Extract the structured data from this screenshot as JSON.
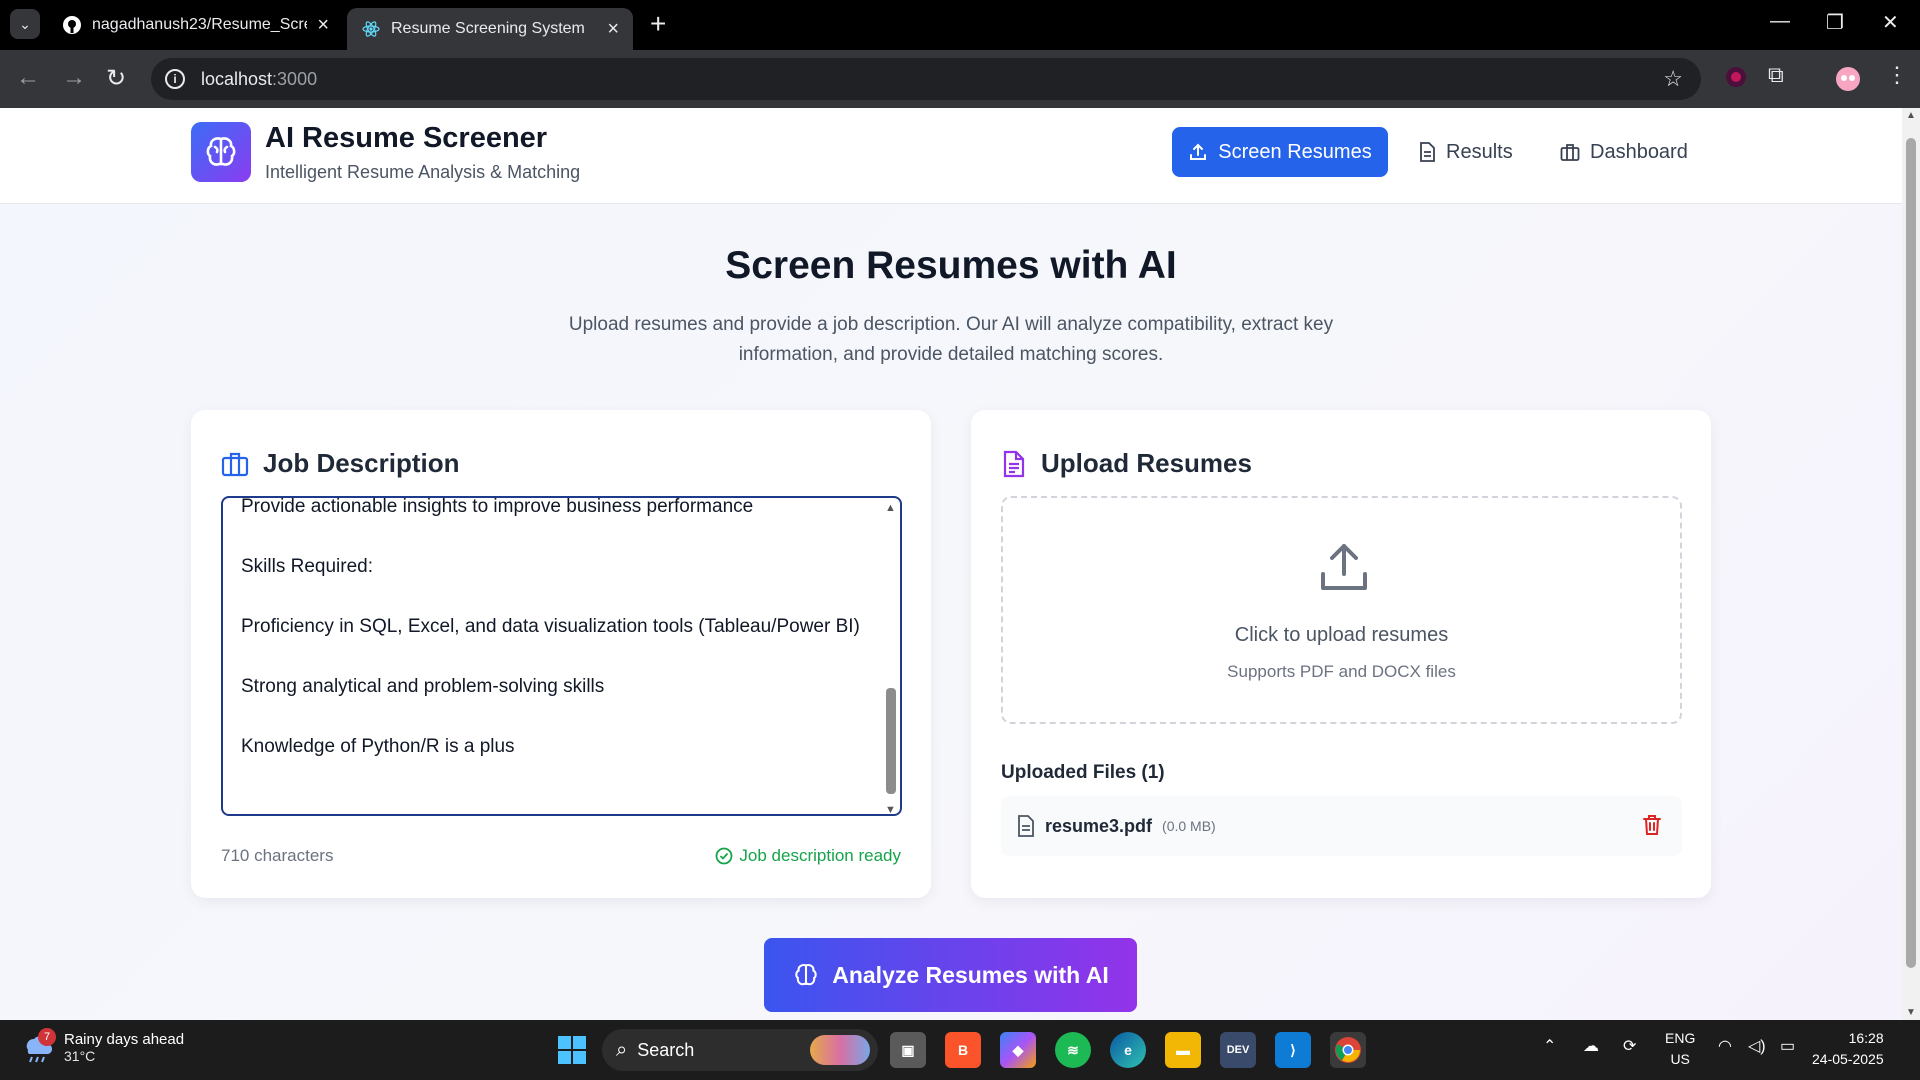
{
  "browser": {
    "tabs": [
      {
        "title": "nagadhanush23/Resume_Scree"
      },
      {
        "title": "Resume Screening System"
      }
    ],
    "url_host": "localhost",
    "url_port": ":3000"
  },
  "header": {
    "title": "AI Resume Screener",
    "subtitle": "Intelligent Resume Analysis & Matching",
    "nav": {
      "screen": "Screen Resumes",
      "results": "Results",
      "dashboard": "Dashboard"
    }
  },
  "hero": {
    "title": "Screen Resumes with AI",
    "subtitle": "Upload resumes and provide a job description. Our AI will analyze compatibility, extract key information, and provide detailed matching scores."
  },
  "job_description": {
    "heading": "Job Description",
    "text": "Provide actionable insights to improve business performance\n\nSkills Required:\n\nProficiency in SQL, Excel, and data visualization tools (Tableau/Power BI)\n\nStrong analytical and problem-solving skills\n\nKnowledge of Python/R is a plus",
    "char_count": "710 characters",
    "status": "Job description ready"
  },
  "upload": {
    "heading": "Upload Resumes",
    "dropzone_main": "Click to upload resumes",
    "dropzone_sub": "Supports PDF and DOCX files",
    "uploaded_title": "Uploaded Files (1)",
    "files": [
      {
        "name": "resume3.pdf",
        "size": "(0.0 MB)"
      }
    ]
  },
  "analyze_button": "Analyze Resumes with AI",
  "taskbar": {
    "weather_badge": "7",
    "weather_title": "Rainy days ahead",
    "weather_temp": "31°C",
    "search": "Search",
    "lang_1": "ENG",
    "lang_2": "US",
    "time": "16:28",
    "date": "24-05-2025"
  },
  "colors": {
    "primary": "#2563eb",
    "success": "#16a34a",
    "danger": "#dc2626",
    "accent_purple": "#9333ea"
  }
}
